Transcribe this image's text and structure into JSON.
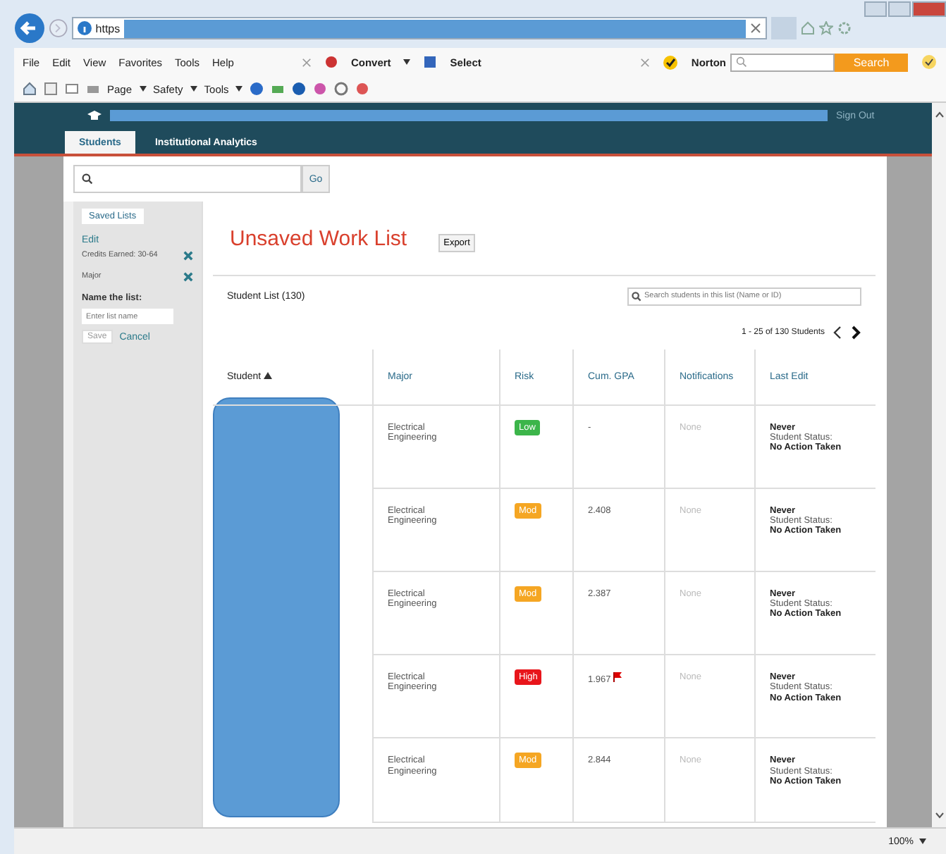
{
  "browser": {
    "address": "https",
    "menu": [
      "File",
      "Edit",
      "View",
      "Favorites",
      "Tools",
      "Help"
    ],
    "addons": [
      "Convert",
      "Select"
    ],
    "norton": "Norton",
    "search_button": "Search",
    "command_bar": [
      "Page",
      "Safety",
      "Tools"
    ],
    "zoom": "100%"
  },
  "app": {
    "sign_out": "Sign Out",
    "tabs": [
      {
        "label": "Students",
        "selected": true
      },
      {
        "label": "Institutional Analytics",
        "selected": false
      }
    ],
    "search_button": "Go"
  },
  "sidebar": {
    "saved_lists": "Saved Lists",
    "edit": "Edit",
    "filters": [
      "Credits Earned: 30-64",
      "Major"
    ],
    "name_label": "Name the list:",
    "name_placeholder": "Enter list name",
    "save": "Save",
    "cancel": "Cancel"
  },
  "main": {
    "title": "Unsaved Work List",
    "export": "Export",
    "list_label": "Student List (130)",
    "search_placeholder": "Search students in this list (Name or ID)",
    "pagination": "1 - 25 of 130 Students"
  },
  "table": {
    "columns": [
      {
        "label": "Student",
        "sorted": true
      },
      {
        "label": "Major",
        "sorted": false
      },
      {
        "label": "Risk",
        "sorted": false
      },
      {
        "label": "Cum. GPA",
        "sorted": false
      },
      {
        "label": "Notifications",
        "sorted": false
      },
      {
        "label": "Last Edit",
        "sorted": false
      }
    ],
    "rows": [
      {
        "major": "Electrical Engineering",
        "risk": "Low",
        "kind": "low",
        "gpa": "-",
        "flagged": false,
        "notifications": "None",
        "last_edit": "Never",
        "status_label": "Student Status:",
        "status": "No Action Taken"
      },
      {
        "major": "Electrical Engineering",
        "risk": "Mod",
        "kind": "mod",
        "gpa": "2.408",
        "flagged": false,
        "notifications": "None",
        "last_edit": "Never",
        "status_label": "Student Status:",
        "status": "No Action Taken"
      },
      {
        "major": "Electrical Engineering",
        "risk": "Mod",
        "kind": "mod",
        "gpa": "2.387",
        "flagged": false,
        "notifications": "None",
        "last_edit": "Never",
        "status_label": "Student Status:",
        "status": "No Action Taken"
      },
      {
        "major": "Electrical Engineering",
        "risk": "High",
        "kind": "high",
        "gpa": "1.967",
        "flagged": true,
        "notifications": "None",
        "last_edit": "Never",
        "status_label": "Student Status:",
        "status": "No Action Taken"
      },
      {
        "major": "Electrical Engineering",
        "risk": "Mod",
        "kind": "mod",
        "gpa": "2.844",
        "flagged": false,
        "notifications": "None",
        "last_edit": "Never",
        "status_label": "Student Status:",
        "status": "No Action Taken"
      }
    ]
  }
}
